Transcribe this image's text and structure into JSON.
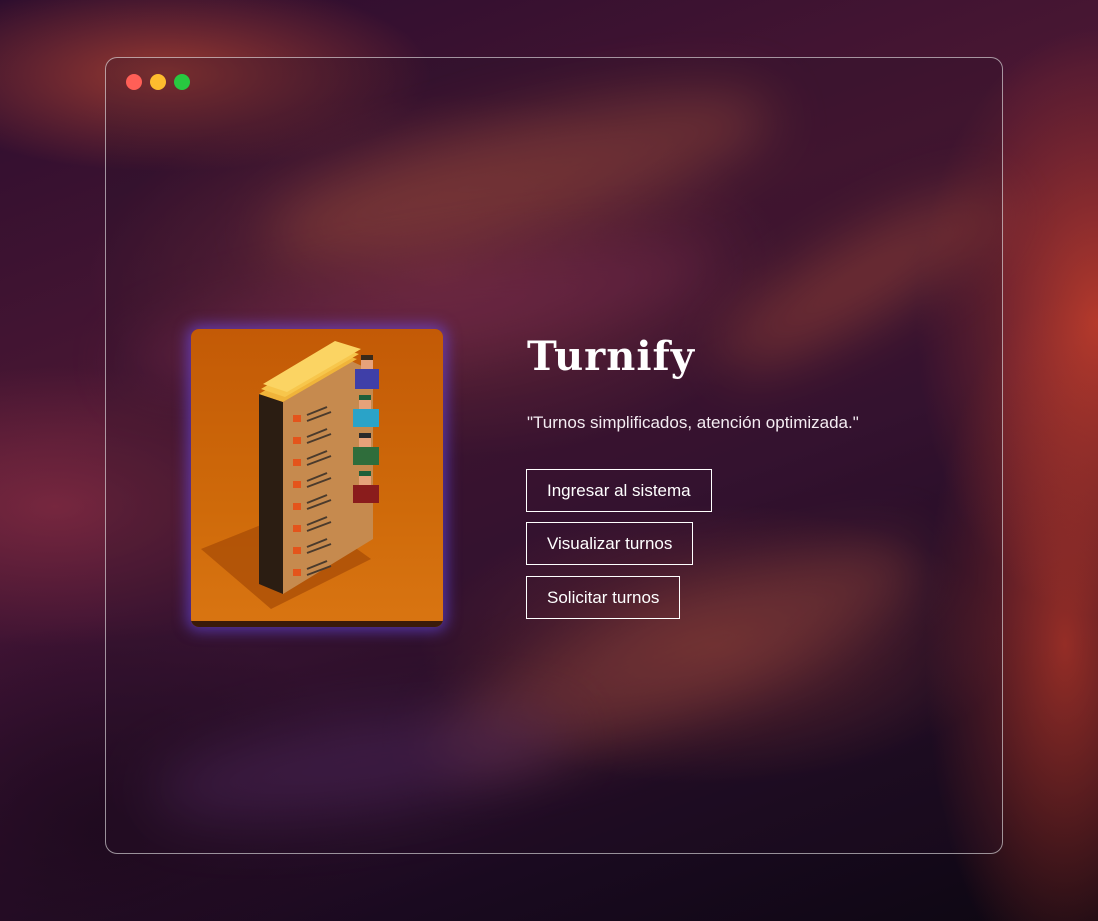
{
  "window": {
    "controls": [
      "close",
      "minimize",
      "maximize"
    ]
  },
  "app": {
    "title": "Turnify",
    "tagline": "\"Turnos simplificados, atención optimizada.\"",
    "illustration": "queue-ticket-tower"
  },
  "menu": {
    "items": [
      {
        "label": "Ingresar al sistema"
      },
      {
        "label": "Visualizar turnos"
      },
      {
        "label": "Solicitar turnos"
      }
    ]
  },
  "colors": {
    "accent_glow": "#6e50ff",
    "illustration_bg": "#cf6a0a",
    "text": "#ffffff"
  }
}
